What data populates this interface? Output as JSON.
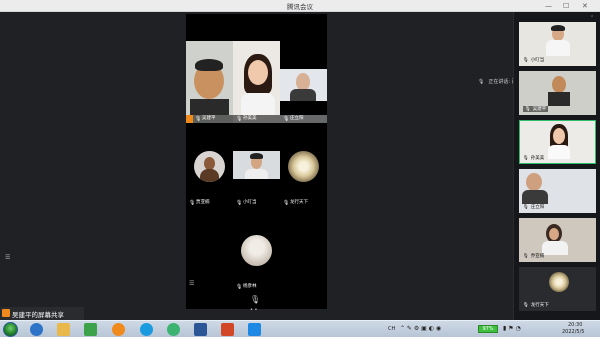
{
  "window": {
    "title": "腾讯会议"
  },
  "meeting": {
    "speaking_label": "正在讲话: 孙美美; 小叮当",
    "share_banner": "吴建平的屏幕共享"
  },
  "grid": {
    "tiles": [
      {
        "name": "吴建平"
      },
      {
        "name": "孙美美"
      },
      {
        "name": "庄立阳"
      },
      {
        "name": "贾亚楠"
      },
      {
        "name": "小叮当"
      },
      {
        "name": "龙行天下"
      },
      {
        "name": "杨彦林"
      }
    ]
  },
  "sidebar": {
    "items": [
      {
        "name": "小叮当"
      },
      {
        "name": "吴建平"
      },
      {
        "name": "孙美美"
      },
      {
        "name": "庄立阳"
      },
      {
        "name": "乔亚楠"
      },
      {
        "name": "龙行天下"
      }
    ]
  },
  "taskbar": {
    "battery": "97%",
    "time": "20:30",
    "date": "2022/5/5",
    "ime": "CH"
  },
  "colors": {
    "active_border": "#2dbc6a",
    "taskbar": "#c5d2e2",
    "background": "#202124"
  }
}
